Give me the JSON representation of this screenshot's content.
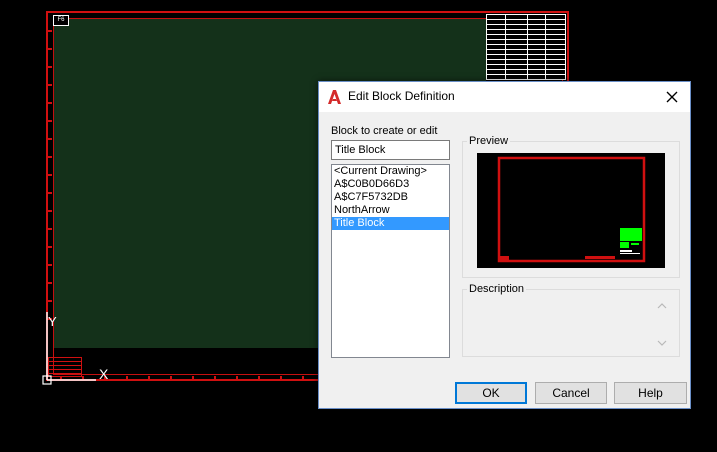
{
  "canvas": {
    "sheet_label": "F6",
    "ucs_x_label": "X",
    "ucs_y_label": "Y"
  },
  "dialog": {
    "title": "Edit Block Definition",
    "block_label": "Block to create or edit",
    "block_value": "Title Block",
    "blocks": [
      {
        "label": "<Current Drawing>",
        "selected": false
      },
      {
        "label": "A$C0B0D66D3",
        "selected": false
      },
      {
        "label": "A$C7F5732DB",
        "selected": false
      },
      {
        "label": "NorthArrow",
        "selected": false
      },
      {
        "label": "Title Block",
        "selected": true
      }
    ],
    "preview_title": "Preview",
    "description_title": "Description",
    "description_value": "",
    "buttons": {
      "ok": "OK",
      "cancel": "Cancel",
      "help": "Help"
    }
  },
  "icons": {
    "app": "autocad-logo-icon",
    "close": "close-icon",
    "scroll_up": "scroll-up-icon",
    "scroll_down": "scroll-down-icon"
  },
  "colors": {
    "cad_background": "#000000",
    "sheet_border": "#d01010",
    "drawing_area": "#14311a",
    "selection": "#3399ff",
    "autocad_red": "#d42a2a",
    "preview_highlight": "#00ff00"
  }
}
